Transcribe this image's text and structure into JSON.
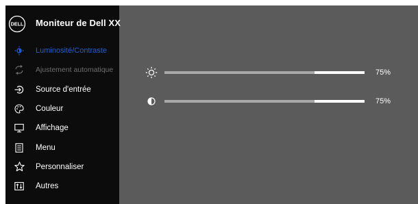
{
  "header": {
    "title": "Moniteur de Dell XX",
    "logo_text": "DELL"
  },
  "menu": {
    "items": [
      {
        "label": "Luminosité/Contraste",
        "icon": "brightness-icon",
        "state": "active"
      },
      {
        "label": "Ajustement automatique",
        "icon": "auto-adjust-icon",
        "state": "disabled"
      },
      {
        "label": "Source d'entrée",
        "icon": "input-source-icon",
        "state": "normal"
      },
      {
        "label": "Couleur",
        "icon": "color-palette-icon",
        "state": "normal"
      },
      {
        "label": "Affichage",
        "icon": "monitor-icon",
        "state": "normal"
      },
      {
        "label": "Menu",
        "icon": "menu-icon",
        "state": "normal"
      },
      {
        "label": "Personnaliser",
        "icon": "star-icon",
        "state": "normal"
      },
      {
        "label": "Autres",
        "icon": "others-icon",
        "state": "normal"
      }
    ]
  },
  "controls": {
    "brightness": {
      "icon": "sun-icon",
      "value": 75,
      "label": "75%"
    },
    "contrast": {
      "icon": "contrast-icon",
      "value": 75,
      "label": "75%"
    }
  },
  "colors": {
    "accent": "#1f5fd6",
    "sidebar_bg": "#0c0c0c",
    "panel_bg": "#5b5b5b",
    "slider_fill": "#a9a9a9",
    "slider_track": "#ffffff",
    "disabled_text": "#6e6e6e"
  }
}
